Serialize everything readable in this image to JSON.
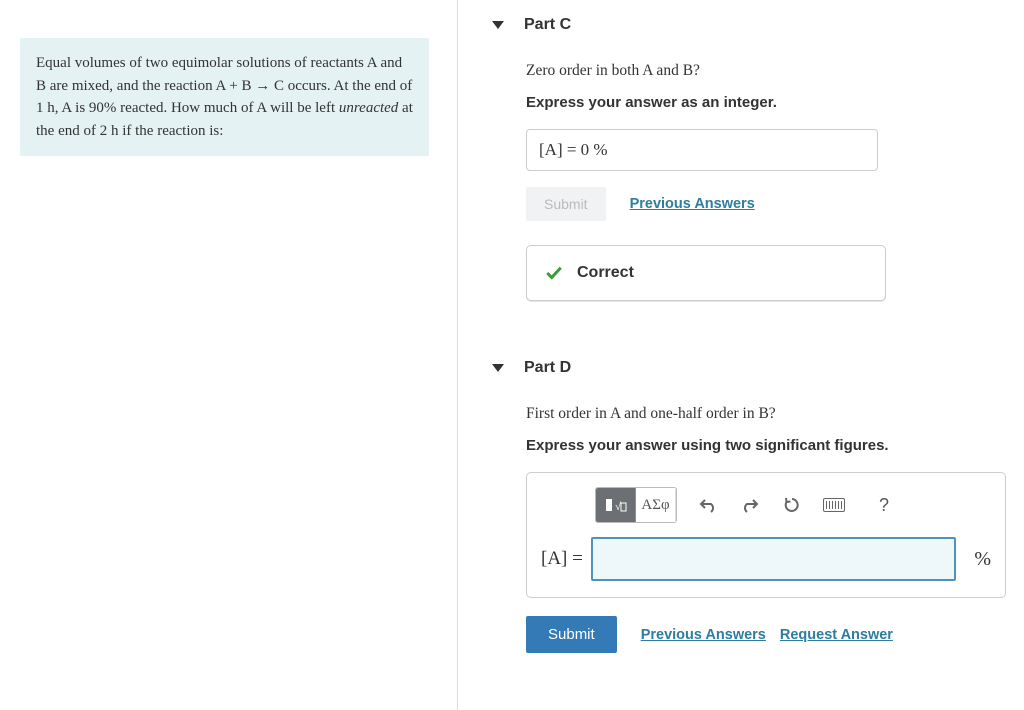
{
  "problem": {
    "line": "Equal volumes of two equimolar solutions of reactants A and B are mixed, and the reaction A + B → C occurs. At the end of 1 h, A is 90% reacted. How much of A will be left unreacted at the end of 2 h if the reaction is:"
  },
  "partC": {
    "title": "Part C",
    "question": "Zero order in both A and B?",
    "instruction": "Express your answer as an integer.",
    "answer_display": "[A] = 0 %",
    "submit_label": "Submit",
    "prev_label": "Previous Answers",
    "feedback": "Correct"
  },
  "partD": {
    "title": "Part D",
    "question": "First order in A and one-half order in B?",
    "instruction": "Express your answer using two significant figures.",
    "label": "[A] =",
    "unit": "%",
    "value": "",
    "symbols_label": "ΑΣφ",
    "help_label": "?",
    "submit_label": "Submit",
    "prev_label": "Previous Answers",
    "request_label": "Request Answer"
  }
}
